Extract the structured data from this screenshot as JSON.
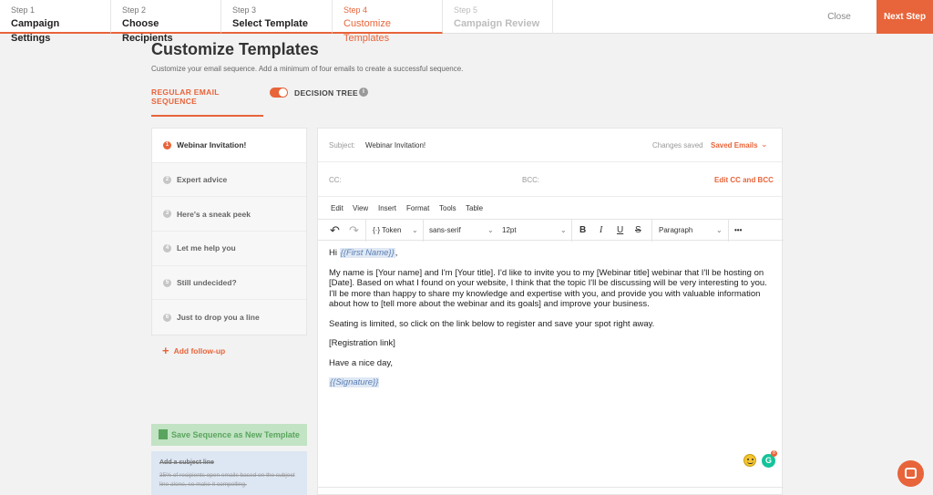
{
  "steps": [
    {
      "num": "Step 1",
      "name": "Campaign Settings",
      "state": "done"
    },
    {
      "num": "Step 2",
      "name": "Choose Recipients",
      "state": "done"
    },
    {
      "num": "Step 3",
      "name": "Select Template",
      "state": "done"
    },
    {
      "num": "Step 4",
      "name": "Customize Templates",
      "state": "active"
    },
    {
      "num": "Step 5",
      "name": "Campaign Review",
      "state": "future"
    }
  ],
  "header": {
    "close_label": "Close",
    "next_label": "Next Step",
    "title": "Customize Templates",
    "subtitle": "Customize your email sequence. Add a minimum of four emails to create a successful sequence.",
    "seq_tab": "REGULAR EMAIL SEQUENCE",
    "tree_label": "DECISION TREE",
    "info_glyph": "i"
  },
  "emails": [
    {
      "num": "1",
      "name": "Webinar Invitation!"
    },
    {
      "num": "2",
      "name": "Expert advice"
    },
    {
      "num": "3",
      "name": "Here's a sneak peek"
    },
    {
      "num": "4",
      "name": "Let me help you"
    },
    {
      "num": "5",
      "name": "Still undecided?"
    },
    {
      "num": "6",
      "name": "Just to drop you a line"
    }
  ],
  "add_followup": "Add follow-up",
  "save_sequence": "Save Sequence as New Template",
  "tip": {
    "title": "Add a subject line",
    "text": "35% of recipients open emails based on the subject line alone, so make it compelling."
  },
  "editor": {
    "subject_label": "Subject:",
    "subject_value": "Webinar Invitation!",
    "changes_saved": "Changes saved",
    "saved_emails": "Saved Emails",
    "cc_label": "CC:",
    "bcc_label": "BCC:",
    "edit_cc": "Edit CC and BCC",
    "menu": [
      "Edit",
      "View",
      "Insert",
      "Format",
      "Tools",
      "Table"
    ],
    "toolbar": {
      "undo": "↶",
      "redo": "↷",
      "token": "{·} Token",
      "font": "sans-serif",
      "size": "12pt",
      "bold": "B",
      "italic": "I",
      "underline": "U",
      "strike": "S",
      "block": "Paragraph",
      "more": "•••"
    },
    "body": {
      "greet": "Hi ",
      "first_name_token": "{{First Name}}",
      "greet_end": ",",
      "p1": "My name is [Your name] and I'm [Your title]. I'd like to invite you to my [Webinar title] webinar that I'll be hosting on [Date]. Based on what I found on your website, I think that the topic I'll be discussing will be very interesting to you. I'll be more than happy to share my knowledge and expertise with you, and provide you with valuable information about how to [tell more about the webinar and its goals] and improve your business.",
      "p2": "Seating is limited, so click on the link below to register and save your spot right away.",
      "p3": "[Registration link]",
      "p4": "Have a nice day,",
      "signature_token": "{{Signature}}"
    },
    "grammarly_glyph": "G",
    "grammarly_badge": "8"
  },
  "colors": {
    "accent": "#e8643a",
    "save_green": "#c2e3c4",
    "tip_blue": "#dde6f3"
  }
}
